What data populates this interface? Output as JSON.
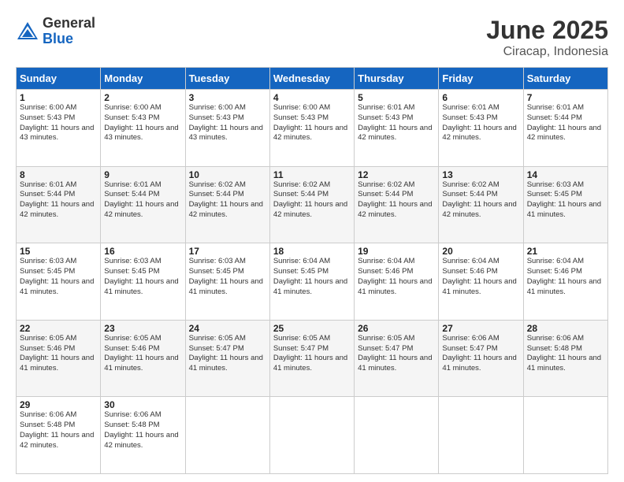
{
  "logo": {
    "general": "General",
    "blue": "Blue"
  },
  "title": "June 2025",
  "subtitle": "Ciracap, Indonesia",
  "headers": [
    "Sunday",
    "Monday",
    "Tuesday",
    "Wednesday",
    "Thursday",
    "Friday",
    "Saturday"
  ],
  "weeks": [
    [
      {
        "day": "1",
        "sunrise": "6:00 AM",
        "sunset": "5:43 PM",
        "daylight": "11 hours and 43 minutes."
      },
      {
        "day": "2",
        "sunrise": "6:00 AM",
        "sunset": "5:43 PM",
        "daylight": "11 hours and 43 minutes."
      },
      {
        "day": "3",
        "sunrise": "6:00 AM",
        "sunset": "5:43 PM",
        "daylight": "11 hours and 43 minutes."
      },
      {
        "day": "4",
        "sunrise": "6:00 AM",
        "sunset": "5:43 PM",
        "daylight": "11 hours and 42 minutes."
      },
      {
        "day": "5",
        "sunrise": "6:01 AM",
        "sunset": "5:43 PM",
        "daylight": "11 hours and 42 minutes."
      },
      {
        "day": "6",
        "sunrise": "6:01 AM",
        "sunset": "5:43 PM",
        "daylight": "11 hours and 42 minutes."
      },
      {
        "day": "7",
        "sunrise": "6:01 AM",
        "sunset": "5:44 PM",
        "daylight": "11 hours and 42 minutes."
      }
    ],
    [
      {
        "day": "8",
        "sunrise": "6:01 AM",
        "sunset": "5:44 PM",
        "daylight": "11 hours and 42 minutes."
      },
      {
        "day": "9",
        "sunrise": "6:01 AM",
        "sunset": "5:44 PM",
        "daylight": "11 hours and 42 minutes."
      },
      {
        "day": "10",
        "sunrise": "6:02 AM",
        "sunset": "5:44 PM",
        "daylight": "11 hours and 42 minutes."
      },
      {
        "day": "11",
        "sunrise": "6:02 AM",
        "sunset": "5:44 PM",
        "daylight": "11 hours and 42 minutes."
      },
      {
        "day": "12",
        "sunrise": "6:02 AM",
        "sunset": "5:44 PM",
        "daylight": "11 hours and 42 minutes."
      },
      {
        "day": "13",
        "sunrise": "6:02 AM",
        "sunset": "5:44 PM",
        "daylight": "11 hours and 42 minutes."
      },
      {
        "day": "14",
        "sunrise": "6:03 AM",
        "sunset": "5:45 PM",
        "daylight": "11 hours and 41 minutes."
      }
    ],
    [
      {
        "day": "15",
        "sunrise": "6:03 AM",
        "sunset": "5:45 PM",
        "daylight": "11 hours and 41 minutes."
      },
      {
        "day": "16",
        "sunrise": "6:03 AM",
        "sunset": "5:45 PM",
        "daylight": "11 hours and 41 minutes."
      },
      {
        "day": "17",
        "sunrise": "6:03 AM",
        "sunset": "5:45 PM",
        "daylight": "11 hours and 41 minutes."
      },
      {
        "day": "18",
        "sunrise": "6:04 AM",
        "sunset": "5:45 PM",
        "daylight": "11 hours and 41 minutes."
      },
      {
        "day": "19",
        "sunrise": "6:04 AM",
        "sunset": "5:46 PM",
        "daylight": "11 hours and 41 minutes."
      },
      {
        "day": "20",
        "sunrise": "6:04 AM",
        "sunset": "5:46 PM",
        "daylight": "11 hours and 41 minutes."
      },
      {
        "day": "21",
        "sunrise": "6:04 AM",
        "sunset": "5:46 PM",
        "daylight": "11 hours and 41 minutes."
      }
    ],
    [
      {
        "day": "22",
        "sunrise": "6:05 AM",
        "sunset": "5:46 PM",
        "daylight": "11 hours and 41 minutes."
      },
      {
        "day": "23",
        "sunrise": "6:05 AM",
        "sunset": "5:46 PM",
        "daylight": "11 hours and 41 minutes."
      },
      {
        "day": "24",
        "sunrise": "6:05 AM",
        "sunset": "5:47 PM",
        "daylight": "11 hours and 41 minutes."
      },
      {
        "day": "25",
        "sunrise": "6:05 AM",
        "sunset": "5:47 PM",
        "daylight": "11 hours and 41 minutes."
      },
      {
        "day": "26",
        "sunrise": "6:05 AM",
        "sunset": "5:47 PM",
        "daylight": "11 hours and 41 minutes."
      },
      {
        "day": "27",
        "sunrise": "6:06 AM",
        "sunset": "5:47 PM",
        "daylight": "11 hours and 41 minutes."
      },
      {
        "day": "28",
        "sunrise": "6:06 AM",
        "sunset": "5:48 PM",
        "daylight": "11 hours and 41 minutes."
      }
    ],
    [
      {
        "day": "29",
        "sunrise": "6:06 AM",
        "sunset": "5:48 PM",
        "daylight": "11 hours and 42 minutes."
      },
      {
        "day": "30",
        "sunrise": "6:06 AM",
        "sunset": "5:48 PM",
        "daylight": "11 hours and 42 minutes."
      },
      null,
      null,
      null,
      null,
      null
    ]
  ]
}
